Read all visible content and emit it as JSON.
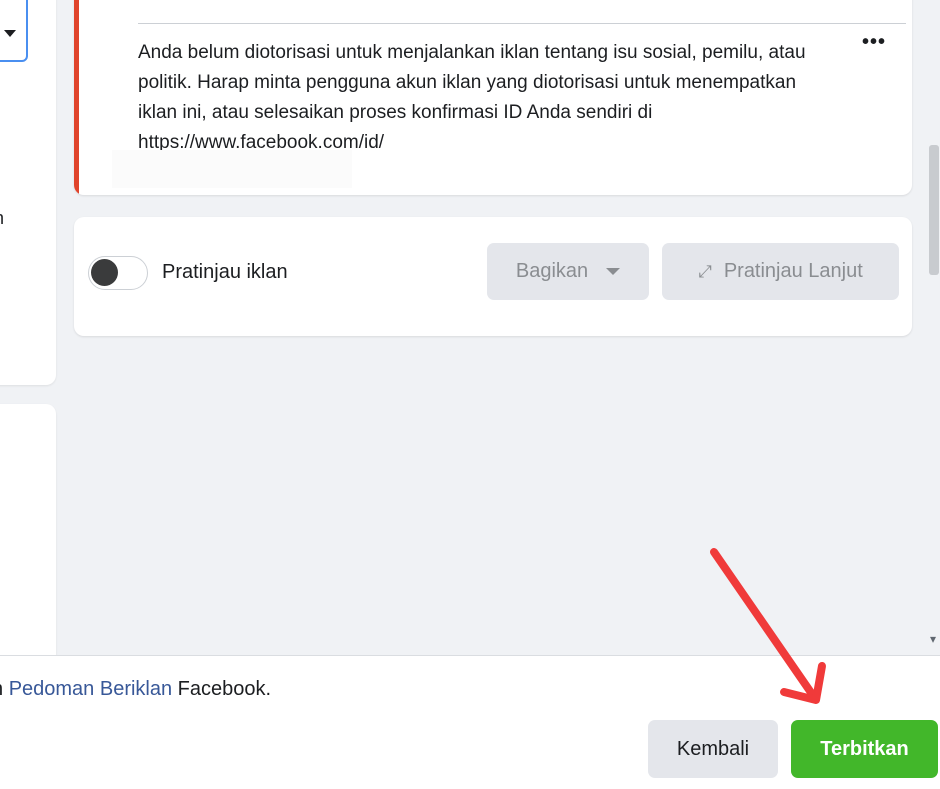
{
  "left_panel": {
    "partial_text": "n"
  },
  "error_card": {
    "message": "Anda belum diotorisasi untuk menjalankan iklan tentang isu sosial, pemilu, atau politik. Harap minta pengguna akun iklan yang diotorisasi untuk menempatkan iklan ini, atau selesaikan proses konfirmasi ID Anda sendiri di https://www.facebook.com/id/",
    "more_label": "•••",
    "accent_color": "#e0442b"
  },
  "preview": {
    "toggle_label": "Pratinjau iklan",
    "toggle_on": false,
    "share_label": "Bagikan",
    "advanced_label": "Pratinjau Lanjut",
    "expand_icon": "⤢"
  },
  "footer": {
    "policy_prefix": "n ",
    "policy_link": "Pedoman Beriklan",
    "policy_suffix": " Facebook.",
    "back_label": "Kembali",
    "publish_label": "Terbitkan",
    "publish_color": "#42b72a"
  },
  "annotation": {
    "arrow_color": "#f03a3a"
  }
}
